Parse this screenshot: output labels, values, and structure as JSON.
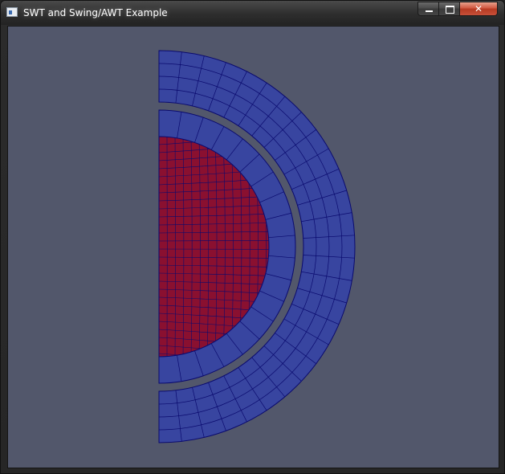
{
  "window": {
    "title": "SWT and Swing/AWT Example",
    "close_symbol": "✕"
  },
  "colors": {
    "background": "#52576b",
    "outer_mesh": "#3845a0",
    "inner_mesh": "#8a1030",
    "mesh_lines": "#0a0a6e"
  },
  "icons": [
    "app-icon",
    "minimize-icon",
    "maximize-icon",
    "close-icon"
  ]
}
